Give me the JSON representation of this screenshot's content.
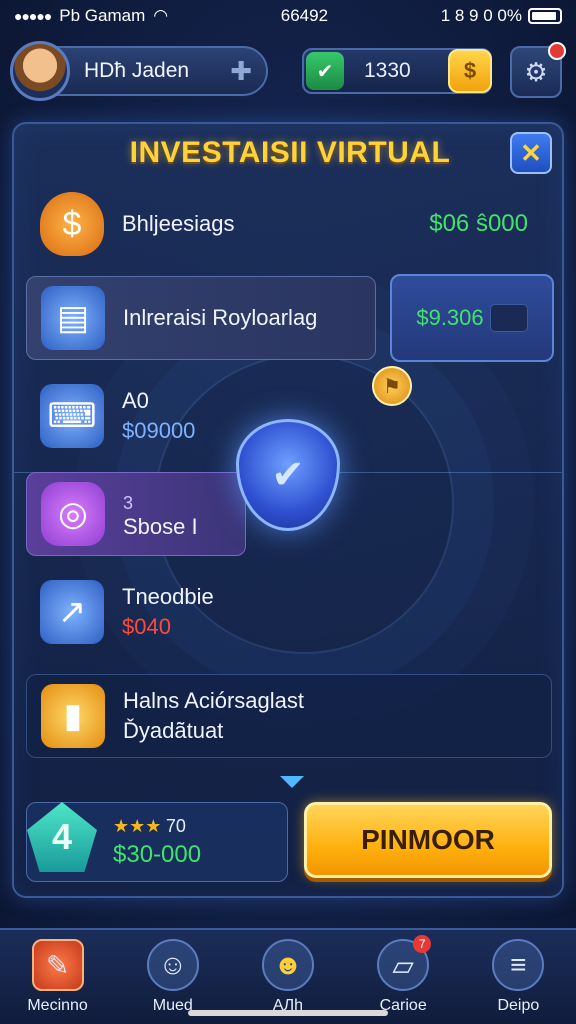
{
  "status_bar": {
    "carrier": "Pb Gamam",
    "time": "66492",
    "battery_text": "1 8 9 0 0%"
  },
  "profile": {
    "name": "HDħ Jaden",
    "add_icon": "plus-icon"
  },
  "currency": {
    "value": "1330",
    "shield_icon": "shield-check-icon",
    "coin_icon": "dollar-coin-icon"
  },
  "panel": {
    "title": "INVESTAISII VIRTUAL",
    "close_icon": "close-icon"
  },
  "rows": [
    {
      "label": "Bhljeesiags",
      "value": "$06 ŝ000",
      "icon": "shield-dollar-icon"
    },
    {
      "label": "Inlreraisi Royloarlag",
      "value": "$9.306",
      "icon": "book-icon"
    },
    {
      "label": "A0",
      "sub": "$09000",
      "icon": "computer-icon"
    },
    {
      "label": "Sbose I",
      "badge": "3",
      "icon": "dial-icon"
    },
    {
      "label": "Tneodbie",
      "sub": "$040",
      "icon": "chart-arrow-icon"
    },
    {
      "label": "Halns Aciórsaglast",
      "sub": "Ďyadãtuat",
      "icon": "folder-chart-icon"
    }
  ],
  "bottom": {
    "level_label": "4",
    "stars": "★★★",
    "stars_text": "70",
    "value": "$30-000",
    "cta": "PINMOOR"
  },
  "tabs": [
    {
      "label": "Mecinno",
      "icon": "pen-icon",
      "active": true
    },
    {
      "label": "Mued",
      "icon": "user-icon",
      "active": false
    },
    {
      "label": "AЛh",
      "icon": "smile-icon",
      "active": false
    },
    {
      "label": "Carioe",
      "icon": "note-icon",
      "active": false,
      "badge": "7"
    },
    {
      "label": "Deipo",
      "icon": "menu-icon",
      "active": false
    }
  ],
  "colors": {
    "accent_gold": "#ffd23a",
    "positive": "#41e36a",
    "negative": "#ff4a3a",
    "panel_border": "#3a5a96"
  }
}
